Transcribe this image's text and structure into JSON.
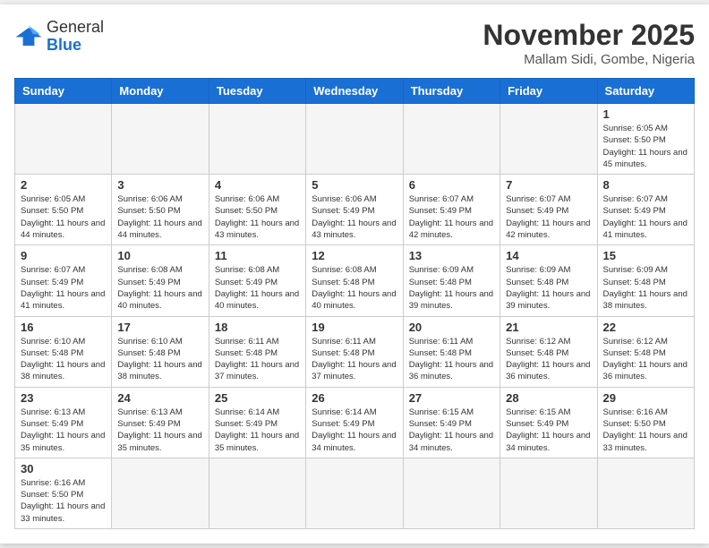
{
  "header": {
    "logo_general": "General",
    "logo_blue": "Blue",
    "month_year": "November 2025",
    "location": "Mallam Sidi, Gombe, Nigeria"
  },
  "weekdays": [
    "Sunday",
    "Monday",
    "Tuesday",
    "Wednesday",
    "Thursday",
    "Friday",
    "Saturday"
  ],
  "weeks": [
    [
      {
        "day": "",
        "sunrise": "",
        "sunset": "",
        "daylight": ""
      },
      {
        "day": "",
        "sunrise": "",
        "sunset": "",
        "daylight": ""
      },
      {
        "day": "",
        "sunrise": "",
        "sunset": "",
        "daylight": ""
      },
      {
        "day": "",
        "sunrise": "",
        "sunset": "",
        "daylight": ""
      },
      {
        "day": "",
        "sunrise": "",
        "sunset": "",
        "daylight": ""
      },
      {
        "day": "",
        "sunrise": "",
        "sunset": "",
        "daylight": ""
      },
      {
        "day": "1",
        "sunrise": "Sunrise: 6:05 AM",
        "sunset": "Sunset: 5:50 PM",
        "daylight": "Daylight: 11 hours and 45 minutes."
      }
    ],
    [
      {
        "day": "2",
        "sunrise": "Sunrise: 6:05 AM",
        "sunset": "Sunset: 5:50 PM",
        "daylight": "Daylight: 11 hours and 44 minutes."
      },
      {
        "day": "3",
        "sunrise": "Sunrise: 6:06 AM",
        "sunset": "Sunset: 5:50 PM",
        "daylight": "Daylight: 11 hours and 44 minutes."
      },
      {
        "day": "4",
        "sunrise": "Sunrise: 6:06 AM",
        "sunset": "Sunset: 5:50 PM",
        "daylight": "Daylight: 11 hours and 43 minutes."
      },
      {
        "day": "5",
        "sunrise": "Sunrise: 6:06 AM",
        "sunset": "Sunset: 5:49 PM",
        "daylight": "Daylight: 11 hours and 43 minutes."
      },
      {
        "day": "6",
        "sunrise": "Sunrise: 6:07 AM",
        "sunset": "Sunset: 5:49 PM",
        "daylight": "Daylight: 11 hours and 42 minutes."
      },
      {
        "day": "7",
        "sunrise": "Sunrise: 6:07 AM",
        "sunset": "Sunset: 5:49 PM",
        "daylight": "Daylight: 11 hours and 42 minutes."
      },
      {
        "day": "8",
        "sunrise": "Sunrise: 6:07 AM",
        "sunset": "Sunset: 5:49 PM",
        "daylight": "Daylight: 11 hours and 41 minutes."
      }
    ],
    [
      {
        "day": "9",
        "sunrise": "Sunrise: 6:07 AM",
        "sunset": "Sunset: 5:49 PM",
        "daylight": "Daylight: 11 hours and 41 minutes."
      },
      {
        "day": "10",
        "sunrise": "Sunrise: 6:08 AM",
        "sunset": "Sunset: 5:49 PM",
        "daylight": "Daylight: 11 hours and 40 minutes."
      },
      {
        "day": "11",
        "sunrise": "Sunrise: 6:08 AM",
        "sunset": "Sunset: 5:49 PM",
        "daylight": "Daylight: 11 hours and 40 minutes."
      },
      {
        "day": "12",
        "sunrise": "Sunrise: 6:08 AM",
        "sunset": "Sunset: 5:48 PM",
        "daylight": "Daylight: 11 hours and 40 minutes."
      },
      {
        "day": "13",
        "sunrise": "Sunrise: 6:09 AM",
        "sunset": "Sunset: 5:48 PM",
        "daylight": "Daylight: 11 hours and 39 minutes."
      },
      {
        "day": "14",
        "sunrise": "Sunrise: 6:09 AM",
        "sunset": "Sunset: 5:48 PM",
        "daylight": "Daylight: 11 hours and 39 minutes."
      },
      {
        "day": "15",
        "sunrise": "Sunrise: 6:09 AM",
        "sunset": "Sunset: 5:48 PM",
        "daylight": "Daylight: 11 hours and 38 minutes."
      }
    ],
    [
      {
        "day": "16",
        "sunrise": "Sunrise: 6:10 AM",
        "sunset": "Sunset: 5:48 PM",
        "daylight": "Daylight: 11 hours and 38 minutes."
      },
      {
        "day": "17",
        "sunrise": "Sunrise: 6:10 AM",
        "sunset": "Sunset: 5:48 PM",
        "daylight": "Daylight: 11 hours and 38 minutes."
      },
      {
        "day": "18",
        "sunrise": "Sunrise: 6:11 AM",
        "sunset": "Sunset: 5:48 PM",
        "daylight": "Daylight: 11 hours and 37 minutes."
      },
      {
        "day": "19",
        "sunrise": "Sunrise: 6:11 AM",
        "sunset": "Sunset: 5:48 PM",
        "daylight": "Daylight: 11 hours and 37 minutes."
      },
      {
        "day": "20",
        "sunrise": "Sunrise: 6:11 AM",
        "sunset": "Sunset: 5:48 PM",
        "daylight": "Daylight: 11 hours and 36 minutes."
      },
      {
        "day": "21",
        "sunrise": "Sunrise: 6:12 AM",
        "sunset": "Sunset: 5:48 PM",
        "daylight": "Daylight: 11 hours and 36 minutes."
      },
      {
        "day": "22",
        "sunrise": "Sunrise: 6:12 AM",
        "sunset": "Sunset: 5:48 PM",
        "daylight": "Daylight: 11 hours and 36 minutes."
      }
    ],
    [
      {
        "day": "23",
        "sunrise": "Sunrise: 6:13 AM",
        "sunset": "Sunset: 5:49 PM",
        "daylight": "Daylight: 11 hours and 35 minutes."
      },
      {
        "day": "24",
        "sunrise": "Sunrise: 6:13 AM",
        "sunset": "Sunset: 5:49 PM",
        "daylight": "Daylight: 11 hours and 35 minutes."
      },
      {
        "day": "25",
        "sunrise": "Sunrise: 6:14 AM",
        "sunset": "Sunset: 5:49 PM",
        "daylight": "Daylight: 11 hours and 35 minutes."
      },
      {
        "day": "26",
        "sunrise": "Sunrise: 6:14 AM",
        "sunset": "Sunset: 5:49 PM",
        "daylight": "Daylight: 11 hours and 34 minutes."
      },
      {
        "day": "27",
        "sunrise": "Sunrise: 6:15 AM",
        "sunset": "Sunset: 5:49 PM",
        "daylight": "Daylight: 11 hours and 34 minutes."
      },
      {
        "day": "28",
        "sunrise": "Sunrise: 6:15 AM",
        "sunset": "Sunset: 5:49 PM",
        "daylight": "Daylight: 11 hours and 34 minutes."
      },
      {
        "day": "29",
        "sunrise": "Sunrise: 6:16 AM",
        "sunset": "Sunset: 5:50 PM",
        "daylight": "Daylight: 11 hours and 33 minutes."
      }
    ],
    [
      {
        "day": "30",
        "sunrise": "Sunrise: 6:16 AM",
        "sunset": "Sunset: 5:50 PM",
        "daylight": "Daylight: 11 hours and 33 minutes."
      },
      {
        "day": "",
        "sunrise": "",
        "sunset": "",
        "daylight": ""
      },
      {
        "day": "",
        "sunrise": "",
        "sunset": "",
        "daylight": ""
      },
      {
        "day": "",
        "sunrise": "",
        "sunset": "",
        "daylight": ""
      },
      {
        "day": "",
        "sunrise": "",
        "sunset": "",
        "daylight": ""
      },
      {
        "day": "",
        "sunrise": "",
        "sunset": "",
        "daylight": ""
      },
      {
        "day": "",
        "sunrise": "",
        "sunset": "",
        "daylight": ""
      }
    ]
  ]
}
